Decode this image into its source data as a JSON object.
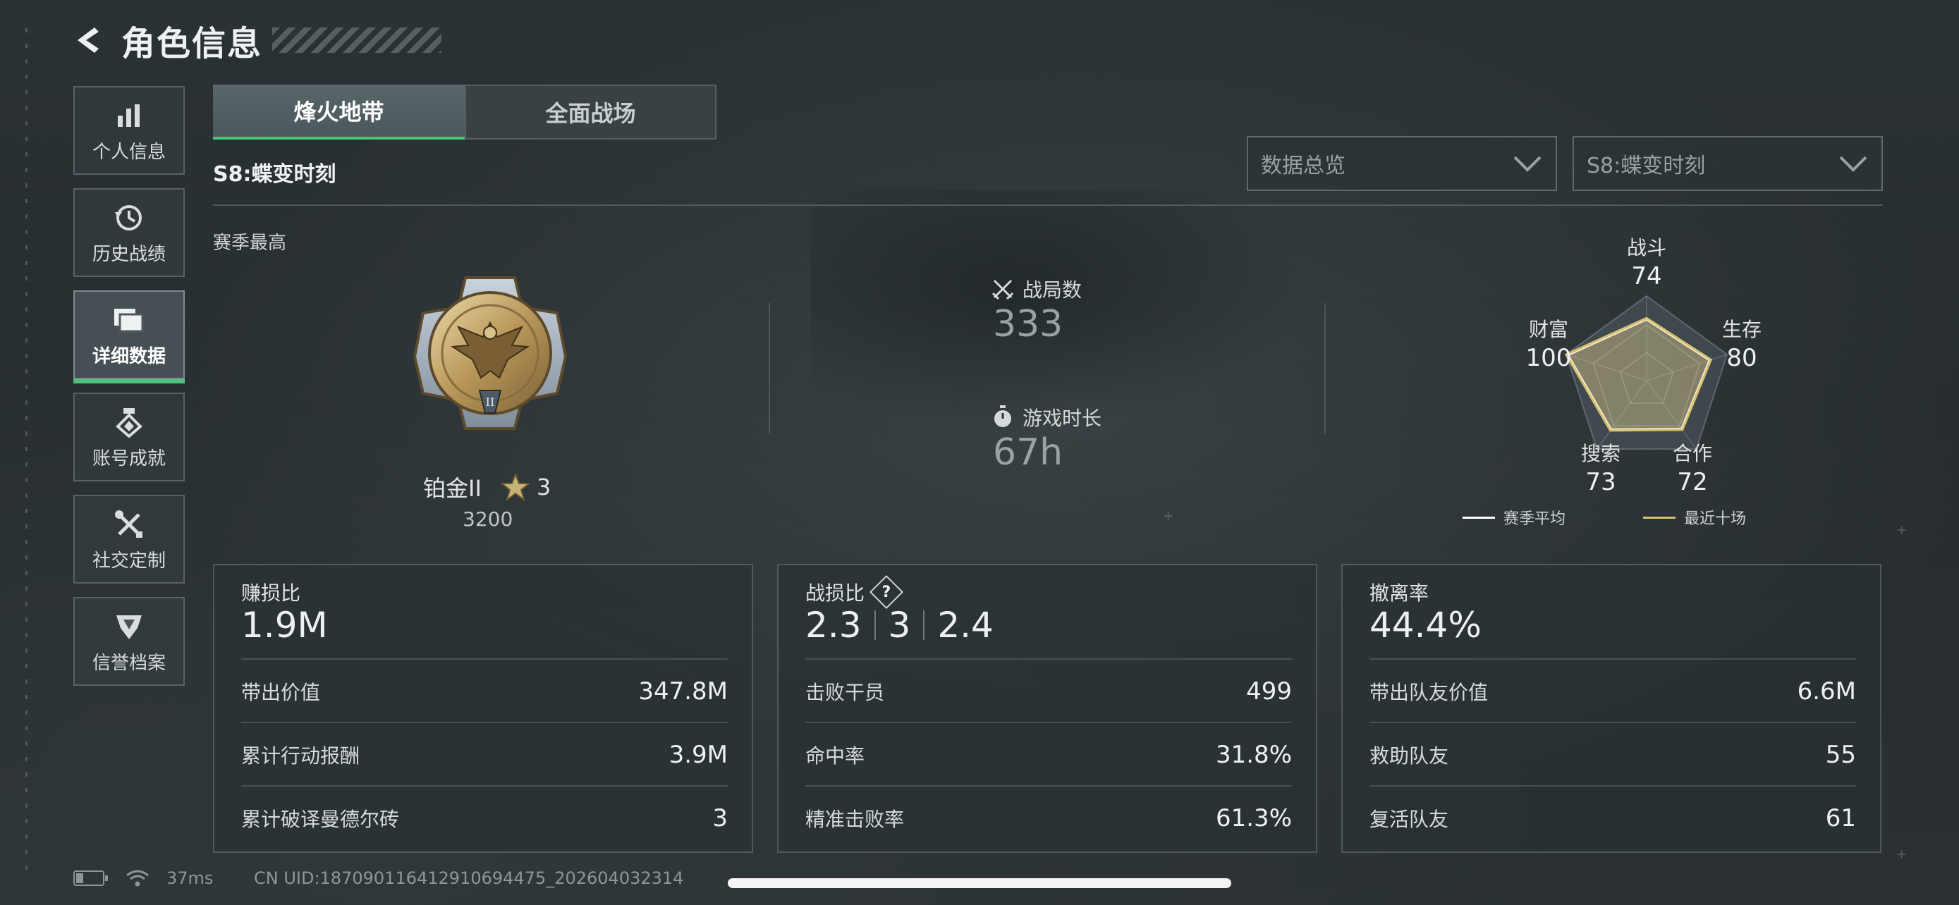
{
  "header": {
    "title": "角色信息"
  },
  "sidebar": {
    "items": [
      {
        "label": "个人信息",
        "icon": "bar-chart-icon"
      },
      {
        "label": "历史战绩",
        "icon": "history-clock-icon"
      },
      {
        "label": "详细数据",
        "icon": "folders-icon",
        "active": true
      },
      {
        "label": "账号成就",
        "icon": "medal-badge-icon"
      },
      {
        "label": "社交定制",
        "icon": "tools-icon"
      },
      {
        "label": "信誉档案",
        "icon": "shield-emblem-icon"
      }
    ]
  },
  "tabs": [
    {
      "label": "烽火地带",
      "active": true
    },
    {
      "label": "全面战场",
      "active": false
    }
  ],
  "season_title": "S8:蝶变时刻",
  "filters": {
    "scope": {
      "value": "数据总览"
    },
    "season": {
      "value": "S8:蝶变时刻"
    }
  },
  "overview": {
    "section_label": "赛季最高",
    "rank": {
      "name": "铂金II",
      "stars": "3",
      "points": "3200"
    },
    "matches": {
      "label": "战局数",
      "value": "333"
    },
    "playtime": {
      "label": "游戏时长",
      "value": "67h"
    }
  },
  "radar": {
    "axes": [
      {
        "label": "战斗",
        "value": "74"
      },
      {
        "label": "生存",
        "value": "80"
      },
      {
        "label": "合作",
        "value": "72"
      },
      {
        "label": "搜索",
        "value": "73"
      },
      {
        "label": "财富",
        "value": "100"
      }
    ],
    "legend": {
      "season_avg": "赛季平均",
      "recent10": "最近十场"
    },
    "colors": {
      "season_avg": "#ffffff",
      "recent10": "#d8c070"
    }
  },
  "cards": {
    "profit": {
      "title": "赚损比",
      "big": "1.9M",
      "rows": [
        {
          "label": "带出价值",
          "value": "347.8M"
        },
        {
          "label": "累计行动报酬",
          "value": "3.9M"
        },
        {
          "label": "累计破译曼德尔砖",
          "value": "3"
        }
      ]
    },
    "kd": {
      "title": "战损比",
      "help": "?",
      "big": [
        "2.3",
        "3",
        "2.4"
      ],
      "rows": [
        {
          "label": "击败干员",
          "value": "499"
        },
        {
          "label": "命中率",
          "value": "31.8%"
        },
        {
          "label": "精准击败率",
          "value": "61.3%"
        }
      ]
    },
    "extract": {
      "title": "撤离率",
      "big": "44.4%",
      "rows": [
        {
          "label": "带出队友价值",
          "value": "6.6M"
        },
        {
          "label": "救助队友",
          "value": "55"
        },
        {
          "label": "复活队友",
          "value": "61"
        }
      ]
    }
  },
  "status": {
    "ping": "37ms",
    "uid": "CN UID:187090116412910694475_202604032314"
  },
  "colors": {
    "accent": "#4cc47a"
  }
}
